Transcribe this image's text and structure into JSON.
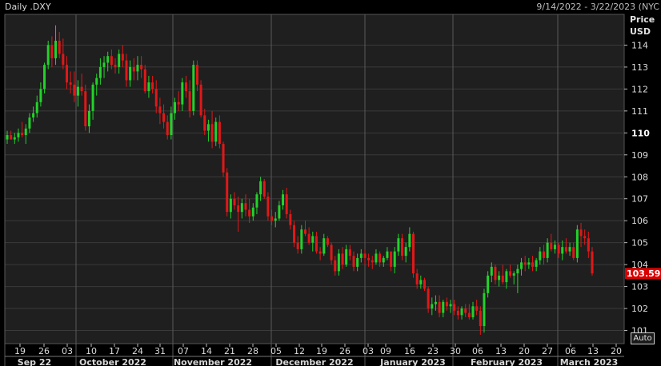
{
  "header": {
    "title": "Daily .DXY",
    "range": "9/14/2022 - 3/22/2023 (NYC"
  },
  "controls": {
    "auto_label": "Auto"
  },
  "chart_data": {
    "type": "candlestick",
    "y_axis": {
      "title": "Price",
      "unit": "USD",
      "ticks": [
        "114",
        "113",
        "112",
        "111",
        "110",
        "109",
        "108",
        "107",
        "106",
        "105",
        "104",
        "103",
        "102",
        "101"
      ],
      "bold_tick": "110",
      "range": [
        100.4,
        115.4
      ]
    },
    "last_price": {
      "label": "103.595",
      "value": 103.595,
      "color": "#d90000"
    },
    "x_axis": {
      "day_ticks": [
        "19",
        "26",
        "03",
        "10",
        "17",
        "24",
        "31",
        "07",
        "14",
        "21",
        "28",
        "05",
        "12",
        "19",
        "26",
        "03",
        "09",
        "16",
        "23",
        "30",
        "06",
        "13",
        "20",
        "27",
        "06",
        "13",
        "20"
      ],
      "months": [
        "Sep 22",
        "October 2022",
        "November 2022",
        "December 2022",
        "January 2023",
        "February 2023",
        "March 2023"
      ]
    },
    "colors": {
      "up": "#22d22a",
      "down": "#e01818",
      "grid": "#3a3a3a",
      "background": "#1f1f1f"
    },
    "candles": [
      [
        109.7,
        110.1,
        109.5,
        109.9
      ],
      [
        109.9,
        110.1,
        109.7,
        109.7
      ],
      [
        109.7,
        110.0,
        109.5,
        109.8
      ],
      [
        109.8,
        110.2,
        109.6,
        110.0
      ],
      [
        110.0,
        110.5,
        109.8,
        109.9
      ],
      [
        109.9,
        110.4,
        109.5,
        110.2
      ],
      [
        110.2,
        110.9,
        110.0,
        110.7
      ],
      [
        110.7,
        111.2,
        110.5,
        110.9
      ],
      [
        110.9,
        111.7,
        110.7,
        111.4
      ],
      [
        111.4,
        112.3,
        111.2,
        112.0
      ],
      [
        112.0,
        113.2,
        111.8,
        113.1
      ],
      [
        113.1,
        114.2,
        112.9,
        114.0
      ],
      [
        114.0,
        114.4,
        113.0,
        113.4
      ],
      [
        113.4,
        114.9,
        113.1,
        114.2
      ],
      [
        114.2,
        114.6,
        113.4,
        113.6
      ],
      [
        113.6,
        114.3,
        112.9,
        113.1
      ],
      [
        113.1,
        113.5,
        112.0,
        112.3
      ],
      [
        112.3,
        112.8,
        111.8,
        112.2
      ],
      [
        112.2,
        112.8,
        111.4,
        111.7
      ],
      [
        111.7,
        112.4,
        111.2,
        112.1
      ],
      [
        112.1,
        112.7,
        111.7,
        111.9
      ],
      [
        111.9,
        112.2,
        110.1,
        110.3
      ],
      [
        110.3,
        111.3,
        110.0,
        111.0
      ],
      [
        111.0,
        112.3,
        110.6,
        112.2
      ],
      [
        112.2,
        112.7,
        111.7,
        112.5
      ],
      [
        112.5,
        113.4,
        112.2,
        113.0
      ],
      [
        113.0,
        113.5,
        112.5,
        113.2
      ],
      [
        113.2,
        113.7,
        112.8,
        113.5
      ],
      [
        113.5,
        113.8,
        112.9,
        113.1
      ],
      [
        113.1,
        113.4,
        112.7,
        113.0
      ],
      [
        113.0,
        113.8,
        112.7,
        113.6
      ],
      [
        113.6,
        114.0,
        113.0,
        113.3
      ],
      [
        113.3,
        113.6,
        112.1,
        112.4
      ],
      [
        112.4,
        113.3,
        112.1,
        113.0
      ],
      [
        113.0,
        113.4,
        112.4,
        112.8
      ],
      [
        112.8,
        113.5,
        112.4,
        113.1
      ],
      [
        113.1,
        113.5,
        112.5,
        112.9
      ],
      [
        112.9,
        113.1,
        111.8,
        111.9
      ],
      [
        111.9,
        112.6,
        111.6,
        112.3
      ],
      [
        112.3,
        112.6,
        111.8,
        112.0
      ],
      [
        112.0,
        112.4,
        110.9,
        111.2
      ],
      [
        111.2,
        111.6,
        110.4,
        110.9
      ],
      [
        110.9,
        111.3,
        110.2,
        110.5
      ],
      [
        110.5,
        110.8,
        109.7,
        109.9
      ],
      [
        109.9,
        111.2,
        109.7,
        110.9
      ],
      [
        110.9,
        111.6,
        110.6,
        111.4
      ],
      [
        111.4,
        111.9,
        111.0,
        111.3
      ],
      [
        111.3,
        112.5,
        111.0,
        112.3
      ],
      [
        112.3,
        112.6,
        111.6,
        111.9
      ],
      [
        111.9,
        112.4,
        110.7,
        111.0
      ],
      [
        111.0,
        113.3,
        110.8,
        113.1
      ],
      [
        113.1,
        113.3,
        111.9,
        112.2
      ],
      [
        112.2,
        112.4,
        110.7,
        110.8
      ],
      [
        110.8,
        111.1,
        109.9,
        110.1
      ],
      [
        110.1,
        110.6,
        109.6,
        110.4
      ],
      [
        110.4,
        111.0,
        109.3,
        109.6
      ],
      [
        109.6,
        110.7,
        109.4,
        110.5
      ],
      [
        110.5,
        110.8,
        109.3,
        109.5
      ],
      [
        109.5,
        109.6,
        108.0,
        108.2
      ],
      [
        108.2,
        108.4,
        106.2,
        106.4
      ],
      [
        106.4,
        107.2,
        106.1,
        107.0
      ],
      [
        107.0,
        107.3,
        106.5,
        106.7
      ],
      [
        106.7,
        107.1,
        105.5,
        106.4
      ],
      [
        106.4,
        107.0,
        106.1,
        106.8
      ],
      [
        106.8,
        107.2,
        106.2,
        106.5
      ],
      [
        106.5,
        107.0,
        105.9,
        106.2
      ],
      [
        106.2,
        106.8,
        106.0,
        106.6
      ],
      [
        106.6,
        107.3,
        106.3,
        107.2
      ],
      [
        107.2,
        108.0,
        106.9,
        107.8
      ],
      [
        107.8,
        107.9,
        107.0,
        107.1
      ],
      [
        107.1,
        107.3,
        106.0,
        106.2
      ],
      [
        106.2,
        106.5,
        105.8,
        106.0
      ],
      [
        106.0,
        106.4,
        105.7,
        106.1
      ],
      [
        106.1,
        106.9,
        106.0,
        106.7
      ],
      [
        106.7,
        107.4,
        106.5,
        107.2
      ],
      [
        107.2,
        107.5,
        106.1,
        106.3
      ],
      [
        106.3,
        106.5,
        105.6,
        105.8
      ],
      [
        105.8,
        106.0,
        104.8,
        105.0
      ],
      [
        105.0,
        105.3,
        104.5,
        104.7
      ],
      [
        104.7,
        105.8,
        104.5,
        105.6
      ],
      [
        105.6,
        106.0,
        105.3,
        105.4
      ],
      [
        105.4,
        105.7,
        104.9,
        105.0
      ],
      [
        105.0,
        105.5,
        104.6,
        105.3
      ],
      [
        105.3,
        105.5,
        104.5,
        104.6
      ],
      [
        104.6,
        104.8,
        104.2,
        104.5
      ],
      [
        104.5,
        105.4,
        104.4,
        105.2
      ],
      [
        105.2,
        105.3,
        104.8,
        104.9
      ],
      [
        104.9,
        105.0,
        104.0,
        104.2
      ],
      [
        104.2,
        104.4,
        103.5,
        103.7
      ],
      [
        103.7,
        104.7,
        103.5,
        104.5
      ],
      [
        104.5,
        104.8,
        103.8,
        104.0
      ],
      [
        104.0,
        104.9,
        103.9,
        104.7
      ],
      [
        104.7,
        104.9,
        104.2,
        104.4
      ],
      [
        104.4,
        104.6,
        103.7,
        103.9
      ],
      [
        103.9,
        104.5,
        103.7,
        104.3
      ],
      [
        104.3,
        104.7,
        104.1,
        104.5
      ],
      [
        104.5,
        104.7,
        104.0,
        104.3
      ],
      [
        104.3,
        104.5,
        103.9,
        104.2
      ],
      [
        104.2,
        104.4,
        103.8,
        104.1
      ],
      [
        104.1,
        104.7,
        104.0,
        104.5
      ],
      [
        104.5,
        104.6,
        103.9,
        104.1
      ],
      [
        104.1,
        104.4,
        103.9,
        104.3
      ],
      [
        104.3,
        104.8,
        104.2,
        104.6
      ],
      [
        104.6,
        104.6,
        103.7,
        103.9
      ],
      [
        103.9,
        104.8,
        103.6,
        104.6
      ],
      [
        104.6,
        105.4,
        104.4,
        105.2
      ],
      [
        105.2,
        105.4,
        104.2,
        104.4
      ],
      [
        104.4,
        105.0,
        104.1,
        104.8
      ],
      [
        104.8,
        105.7,
        104.6,
        105.4
      ],
      [
        105.4,
        105.5,
        103.4,
        103.6
      ],
      [
        103.6,
        103.8,
        102.9,
        103.1
      ],
      [
        103.1,
        103.5,
        102.9,
        103.3
      ],
      [
        103.3,
        103.4,
        102.8,
        102.9
      ],
      [
        102.9,
        103.0,
        101.8,
        102.0
      ],
      [
        102.0,
        102.5,
        101.7,
        102.2
      ],
      [
        102.2,
        102.6,
        101.9,
        102.3
      ],
      [
        102.3,
        102.6,
        101.6,
        101.8
      ],
      [
        101.8,
        102.4,
        101.6,
        102.3
      ],
      [
        102.3,
        102.5,
        101.9,
        102.1
      ],
      [
        102.1,
        102.4,
        101.8,
        102.2
      ],
      [
        102.2,
        102.4,
        101.7,
        101.9
      ],
      [
        101.9,
        102.1,
        101.5,
        101.7
      ],
      [
        101.7,
        102.1,
        101.5,
        102.0
      ],
      [
        102.0,
        102.2,
        101.6,
        101.8
      ],
      [
        101.8,
        102.2,
        101.5,
        101.6
      ],
      [
        101.6,
        102.3,
        101.5,
        102.1
      ],
      [
        102.1,
        102.4,
        101.7,
        101.9
      ],
      [
        101.9,
        102.1,
        100.8,
        101.2
      ],
      [
        101.2,
        102.9,
        100.9,
        102.7
      ],
      [
        102.7,
        103.7,
        102.5,
        103.5
      ],
      [
        103.5,
        104.1,
        103.2,
        103.9
      ],
      [
        103.9,
        104.0,
        103.1,
        103.3
      ],
      [
        103.3,
        103.7,
        103.0,
        103.5
      ],
      [
        103.5,
        104.0,
        103.1,
        103.2
      ],
      [
        103.2,
        103.8,
        102.9,
        103.7
      ],
      [
        103.7,
        104.0,
        103.4,
        103.5
      ],
      [
        103.5,
        103.7,
        103.1,
        103.6
      ],
      [
        103.6,
        104.0,
        102.7,
        103.8
      ],
      [
        103.8,
        104.3,
        103.5,
        104.1
      ],
      [
        104.1,
        104.4,
        103.7,
        104.0
      ],
      [
        104.0,
        104.3,
        103.8,
        104.1
      ],
      [
        104.1,
        104.4,
        103.7,
        103.9
      ],
      [
        103.9,
        104.3,
        103.7,
        104.2
      ],
      [
        104.2,
        104.8,
        104.0,
        104.6
      ],
      [
        104.6,
        104.9,
        104.0,
        104.3
      ],
      [
        104.3,
        105.2,
        104.1,
        105.0
      ],
      [
        105.0,
        105.4,
        104.6,
        104.7
      ],
      [
        104.7,
        105.1,
        104.5,
        104.9
      ],
      [
        104.9,
        105.0,
        104.3,
        104.5
      ],
      [
        104.5,
        105.1,
        104.2,
        104.8
      ],
      [
        104.8,
        105.2,
        104.5,
        104.6
      ],
      [
        104.6,
        105.0,
        104.4,
        104.8
      ],
      [
        104.8,
        105.0,
        104.2,
        104.3
      ],
      [
        104.3,
        105.8,
        104.1,
        105.6
      ],
      [
        105.6,
        105.9,
        104.8,
        105.3
      ],
      [
        105.3,
        105.6,
        104.9,
        105.2
      ],
      [
        105.2,
        105.5,
        104.3,
        104.6
      ],
      [
        104.6,
        104.8,
        103.5,
        103.6
      ]
    ]
  }
}
